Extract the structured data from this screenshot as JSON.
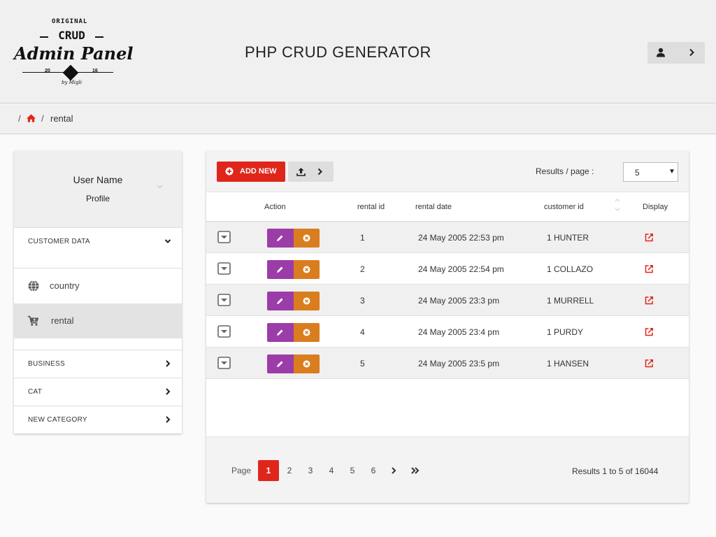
{
  "logo": {
    "top": "ORIGINAL",
    "crud": "CRUD",
    "main": "Admin Panel",
    "year_left": "20",
    "year_right": "16",
    "by": "by Migli"
  },
  "header": {
    "title": "PHP CRUD GENERATOR",
    "user_icon": "user-icon",
    "menu_icon": "chevron-right-icon"
  },
  "breadcrumb": {
    "separator": "/",
    "home_icon": "home-icon",
    "current": "rental"
  },
  "sidebar": {
    "user_name": "User Name",
    "profile_label": "Profile",
    "sections": [
      {
        "label": "CUSTOMER DATA",
        "expanded": true
      },
      {
        "label": "BUSINESS",
        "expanded": false
      },
      {
        "label": "CAT",
        "expanded": false
      },
      {
        "label": "NEW CATEGORY",
        "expanded": false
      }
    ],
    "items": [
      {
        "label": "country",
        "icon": "globe-icon",
        "active": false
      },
      {
        "label": "rental",
        "icon": "cart-plus-icon",
        "active": true
      }
    ]
  },
  "toolbar": {
    "add_label": "ADD NEW",
    "export_icon": "upload-icon",
    "results_per_page_label": "Results / page :",
    "results_per_page_value": "5"
  },
  "table": {
    "columns": [
      "Action",
      "rental id",
      "rental date",
      "customer id",
      "Display"
    ],
    "rows": [
      {
        "rental_id": "1",
        "rental_date": "24 May 2005 22:53 pm",
        "customer": "1 HUNTER"
      },
      {
        "rental_id": "2",
        "rental_date": "24 May 2005 22:54 pm",
        "customer": "1 COLLAZO"
      },
      {
        "rental_id": "3",
        "rental_date": "24 May 2005 23:3 pm",
        "customer": "1 MURRELL"
      },
      {
        "rental_id": "4",
        "rental_date": "24 May 2005 23:4 pm",
        "customer": "1 PURDY"
      },
      {
        "rental_id": "5",
        "rental_date": "24 May 2005 23:5 pm",
        "customer": "1 HANSEN"
      }
    ]
  },
  "pagination": {
    "label": "Page",
    "pages": [
      "1",
      "2",
      "3",
      "4",
      "5",
      "6"
    ],
    "current": "1",
    "info": "Results 1 to 5 of 16044"
  },
  "colors": {
    "accent_red": "#e0261b",
    "edit_purple": "#9c3ca8",
    "delete_orange": "#da7d1f"
  }
}
